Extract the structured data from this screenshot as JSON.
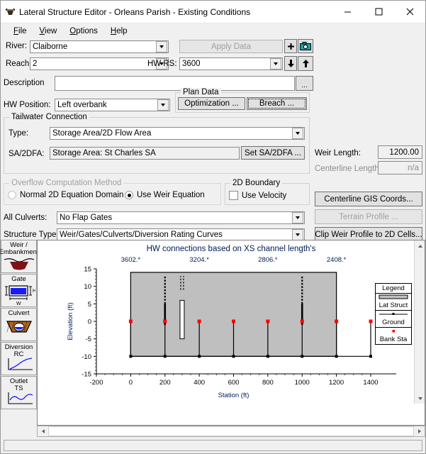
{
  "window": {
    "title": "Lateral Structure Editor - Orleans Parish - Existing Conditions",
    "icon": "lateral-structure-icon",
    "minimize": "–",
    "maximize": "☐",
    "close": "✕"
  },
  "menu": [
    {
      "label": "File",
      "accel": "F"
    },
    {
      "label": "View",
      "accel": "V"
    },
    {
      "label": "Options",
      "accel": "O"
    },
    {
      "label": "Help",
      "accel": "H"
    }
  ],
  "form": {
    "river_label": "River:",
    "river_value": "Claiborne",
    "reach_label": "Reach:",
    "reach_value": "2",
    "hwrs_label": "HW RS:",
    "hwrs_value": "3600",
    "apply_data": "Apply Data",
    "description_label": "Description",
    "description_value": "",
    "description_more": "...",
    "hw_position_label": "HW Position:",
    "hw_position_value": "Left overbank",
    "add_icon": "plus-icon",
    "camera_icon": "camera-icon",
    "down_icon": "down-arrow-icon",
    "up_icon": "up-arrow-icon"
  },
  "plan_data": {
    "title": "Plan Data",
    "optimization": "Optimization ...",
    "breach": "Breach ..."
  },
  "tailwater": {
    "title": "Tailwater Connection",
    "type_label": "Type:",
    "type_value": "Storage Area/2D Flow Area",
    "sa_label": "SA/2DFA:",
    "sa_value": "Storage Area: St Charles SA",
    "set_sa_button": "Set SA/2DFA ...",
    "weir_length_label": "Weir Length:",
    "weir_length_value": "1200.00",
    "centerline_length_label": "Centerline Length:",
    "centerline_length_value": "n/a"
  },
  "overflow": {
    "title": "Overflow Computation Method",
    "option_normal": "Normal 2D Equation Domain",
    "option_weir": "Use Weir Equation",
    "selected": "weir"
  },
  "boundary2d": {
    "title": "2D Boundary",
    "use_velocity": "Use Velocity",
    "use_velocity_checked": false
  },
  "buttons": {
    "centerline_gis": "Centerline GIS Coords...",
    "terrain_profile": "Terrain Profile ...",
    "clip_weir": "Clip Weir Profile to 2D Cells..."
  },
  "culverts": {
    "label": "All Culverts:",
    "value": "No Flap Gates"
  },
  "structure_type": {
    "label": "Structure Type:",
    "value": "Weir/Gates/Culverts/Diversion Rating Curves"
  },
  "toolbar": [
    {
      "name": "weir-embankment",
      "line1": "Weir /",
      "line2": "Embankment",
      "icon": "weir-embankment-icon"
    },
    {
      "name": "gate",
      "line1": "Gate",
      "line2": "",
      "icon": "gate-icon"
    },
    {
      "name": "culvert",
      "line1": "Culvert",
      "line2": "",
      "icon": "culvert-icon"
    },
    {
      "name": "diversion-rc",
      "line1": "Diversion",
      "line2": "RC",
      "icon": "diversion-rc-icon"
    },
    {
      "name": "outlet-ts",
      "line1": "Outlet",
      "line2": "TS",
      "icon": "outlet-ts-icon"
    }
  ],
  "legend": {
    "title": "Legend",
    "items": [
      {
        "label": "Lat Struct",
        "symbol": "gray-bar",
        "color": "#bfbfbf"
      },
      {
        "label": "Ground",
        "symbol": "line-dot",
        "color": "#000000"
      },
      {
        "label": "Bank Sta",
        "symbol": "red-dot",
        "color": "#ff0000"
      }
    ]
  },
  "chart_data": {
    "type": "line",
    "title": "HW connections based on XS channel length's",
    "xlabel": "Station (ft)",
    "ylabel": "Elevation (ft)",
    "xlim": [
      -200,
      1400
    ],
    "ylim": [
      -15,
      15
    ],
    "xticks": [
      -200,
      0,
      200,
      400,
      600,
      800,
      1000,
      1200,
      1400
    ],
    "yticks": [
      -15,
      -10,
      -5,
      0,
      5,
      10,
      15
    ],
    "grid": false,
    "legend_position": "right",
    "xs_labels": [
      {
        "text": "3602.*",
        "station": 0
      },
      {
        "text": "3204.*",
        "station": 400
      },
      {
        "text": "2806.*",
        "station": 800
      },
      {
        "text": "2408.*",
        "station": 1200
      }
    ],
    "lat_struct": {
      "name": "Lat Struct",
      "color": "#bfbfbf",
      "top_elevation": 14,
      "bottom_elevation": -10,
      "station_start": 0,
      "station_end": 1200
    },
    "ground": {
      "name": "Ground",
      "color": "#000000",
      "elevation": -10,
      "points": [
        {
          "station": 0,
          "elevation": -10
        },
        {
          "station": 200,
          "elevation": -10
        },
        {
          "station": 400,
          "elevation": -10
        },
        {
          "station": 600,
          "elevation": -10
        },
        {
          "station": 800,
          "elevation": -10
        },
        {
          "station": 1000,
          "elevation": -10
        },
        {
          "station": 1200,
          "elevation": -10
        },
        {
          "station": 1400,
          "elevation": -10
        }
      ]
    },
    "bank_sta": {
      "name": "Bank Sta",
      "color": "#ff0000",
      "elevation": 0,
      "stations": [
        0,
        200,
        400,
        600,
        800,
        1000,
        1200,
        1400
      ]
    },
    "connectors": {
      "color": "#000000",
      "stations": [
        0,
        200,
        400,
        600,
        800,
        1000,
        1200,
        1400
      ],
      "top_elevation": 0,
      "bottom_elevation": -10
    },
    "gates": [
      {
        "station": 200,
        "type": "dashed-solid",
        "top": 9,
        "bottom": -1
      },
      {
        "station": 300,
        "type": "open-rect",
        "top": 9,
        "bottom": -5
      },
      {
        "station": 1000,
        "type": "dashed-solid",
        "top": 9,
        "bottom": -1
      }
    ]
  }
}
